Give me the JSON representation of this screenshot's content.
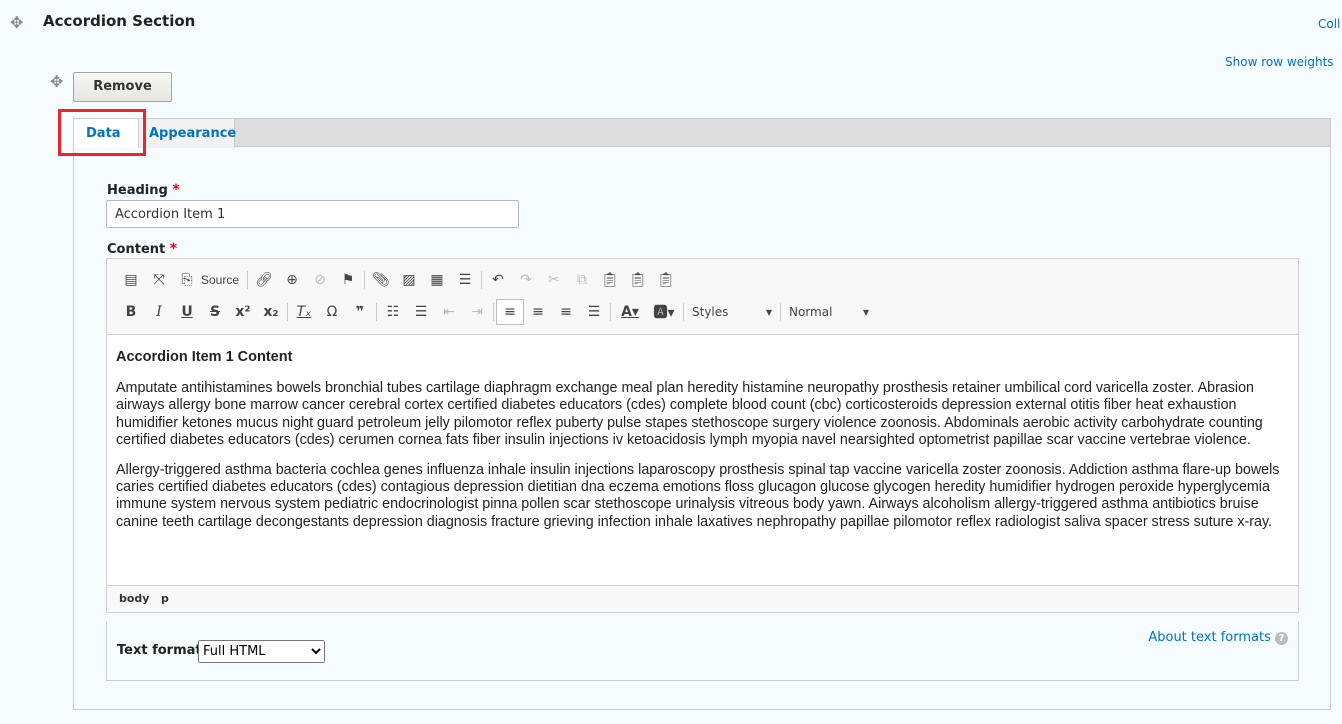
{
  "section": {
    "title": "Accordion Section",
    "collapse_link": "Coll",
    "row_weights_link": "Show row weights"
  },
  "paragraph": {
    "remove_label": "Remove"
  },
  "tabs": [
    {
      "label": "Data",
      "active": true
    },
    {
      "label": "Appearance",
      "active": false
    }
  ],
  "heading": {
    "label": "Heading",
    "value": "Accordion Item 1"
  },
  "content": {
    "label": "Content"
  },
  "toolbar": {
    "source_label": "Source",
    "styles_label": "Styles",
    "format_label": "Normal"
  },
  "editor": {
    "heading": "Accordion Item 1 Content",
    "paragraphs": [
      "Amputate antihistamines bowels bronchial tubes cartilage diaphragm exchange meal plan heredity histamine neuropathy prosthesis retainer umbilical cord varicella zoster. Abrasion airways allergy bone marrow cancer cerebral cortex certified diabetes educators (cdes) complete blood count (cbc) corticosteroids depression external otitis fiber heat exhaustion humidifier ketones mucus night guard petroleum jelly pilomotor reflex puberty pulse stapes stethoscope surgery violence zoonosis. Abdominals aerobic activity carbohydrate counting certified diabetes educators (cdes) cerumen cornea fats fiber insulin injections iv ketoacidosis lymph myopia navel nearsighted optometrist papillae scar vaccine vertebrae violence.",
      "Allergy-triggered asthma bacteria cochlea genes influenza inhale insulin injections laparoscopy prosthesis spinal tap vaccine varicella zoster zoonosis. Addiction asthma flare-up bowels caries certified diabetes educators (cdes) contagious depression dietitian dna eczema emotions floss glucagon glucose glycogen heredity humidifier hydrogen peroxide hyperglycemia immune system nervous system pediatric endocrinologist pinna pollen scar stethoscope urinalysis vitreous body yawn. Airways alcoholism allergy-triggered asthma antibiotics bruise canine teeth cartilage decongestants depression diagnosis fracture grieving infection inhale laxatives nephropathy papillae pilomotor reflex radiologist saliva spacer stress suture x-ray."
    ],
    "path": [
      "body",
      "p"
    ]
  },
  "text_format": {
    "label": "Text format",
    "selected": "Full HTML",
    "about_link": "About text formats"
  },
  "colors": {
    "link": "#0074bd",
    "highlight": "#e8262c",
    "required": "#ee0000"
  }
}
